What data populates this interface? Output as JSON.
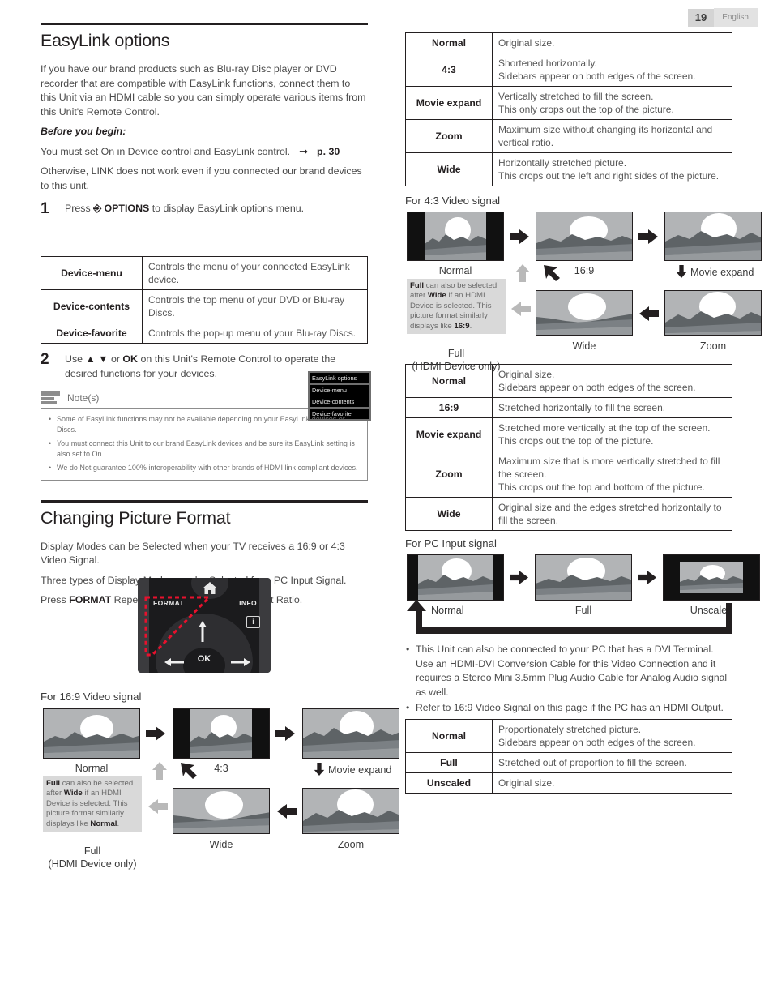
{
  "header": {
    "page_number": "19",
    "language": "English"
  },
  "left": {
    "section1_title": "EasyLink options",
    "intro": "If you have our brand products such as Blu-ray Disc player or DVD recorder that are compatible with EasyLink functions, connect them to this Unit via an HDMI cable so you can simply operate various items from this Unit's Remote Control.",
    "before_you_begin": "Before you begin:",
    "must_set": "You must set On in Device control and EasyLink control.",
    "page_ref": "p. 30",
    "otherwise": "Otherwise, LINK does not work even if you connected our brand devices to this unit.",
    "step1_num": "1",
    "step1_pre": "Press",
    "step1_options": "OPTIONS",
    "step1_post": "to display EasyLink options menu.",
    "osd_menu": [
      "EasyLink options",
      "Device-menu",
      "Device-contents",
      "Device-favorite"
    ],
    "easylink_table": [
      {
        "key": "Device-menu",
        "desc": "Controls the menu of your connected EasyLink device."
      },
      {
        "key": "Device-contents",
        "desc": "Controls the top menu of your DVD or Blu-ray Discs."
      },
      {
        "key": "Device-favorite",
        "desc": "Controls the pop-up menu of your Blu-ray Discs."
      }
    ],
    "step2_num": "2",
    "step2_a": "Use",
    "step2_arrows": "▲ ▼",
    "step2_b": "or",
    "step2_ok": "OK",
    "step2_c": "on this Unit's Remote Control to operate the desired functions for your devices.",
    "notes_label": "Note(s)",
    "notes": [
      "Some of EasyLink functions may not be available depending on your EasyLink devices or Discs.",
      "You must connect this Unit to our brand EasyLink devices and be sure its EasyLink setting is also set to On.",
      "We do Not guarantee 100% interoperability with other brands of HDMI link compliant devices."
    ],
    "section2_title": "Changing Picture Format",
    "pf_p1": "Display Modes can be Selected when your TV receives a 16:9 or 4:3 Video Signal.",
    "pf_p2": "Three types of Display Modes can be Selected for a PC Input Signal.",
    "pf_p3_a": "Press",
    "pf_p3_b": "FORMAT",
    "pf_p3_c": "Repeatedly to Switch the TV Aspect Ratio.",
    "remote": {
      "format_label": "FORMAT",
      "info_label": "INFO",
      "ok_label": "OK",
      "info_glyph": "i"
    },
    "diagram_169_title": "For 16:9 Video signal",
    "diagram_169": {
      "captions": [
        "Normal",
        "4:3",
        "Movie expand",
        "Wide",
        "Zoom"
      ],
      "full_caption": "Full",
      "full_sub": "(HDMI Device only)",
      "note_parts": [
        "Full",
        " can also be selected after ",
        "Wide",
        " if an HDMI Device is selected. This picture format similarly displays like ",
        "Normal",
        "."
      ]
    }
  },
  "right": {
    "table_169": [
      {
        "key": "Normal",
        "lines": [
          "Original size."
        ]
      },
      {
        "key": "4:3",
        "lines": [
          "Shortened horizontally.",
          "Sidebars appear on both edges of the screen."
        ]
      },
      {
        "key": "Movie expand",
        "lines": [
          "Vertically stretched to fill the screen.",
          "This only crops out the top of the picture."
        ]
      },
      {
        "key": "Zoom",
        "lines": [
          "Maximum size without changing its horizontal and vertical ratio."
        ]
      },
      {
        "key": "Wide",
        "lines": [
          "Horizontally stretched picture.",
          "This crops out the left and right sides of the picture."
        ]
      }
    ],
    "diagram_43_title": "For 4:3 Video signal",
    "diagram_43": {
      "captions": [
        "Normal",
        "16:9",
        "Movie expand",
        "Wide",
        "Zoom"
      ],
      "full_caption": "Full",
      "full_sub": "(HDMI Device only)",
      "note_parts": [
        "Full",
        " can also be selected after ",
        "Wide",
        " if an HDMI Device is selected. This picture format similarly displays like ",
        "16:9",
        "."
      ]
    },
    "table_43": [
      {
        "key": "Normal",
        "lines": [
          "Original size.",
          "Sidebars appear on both edges of the screen."
        ]
      },
      {
        "key": "16:9",
        "lines": [
          "Stretched horizontally to fill the screen."
        ]
      },
      {
        "key": "Movie expand",
        "lines": [
          "Stretched more vertically at the top of the screen.",
          "This crops out the top of the picture."
        ]
      },
      {
        "key": "Zoom",
        "lines": [
          "Maximum size that is more vertically stretched to fill the screen.",
          "This crops out the top and bottom of the picture."
        ]
      },
      {
        "key": "Wide",
        "lines": [
          "Original size and the edges stretched horizontally to fill the screen."
        ]
      }
    ],
    "diagram_pc_title": "For PC Input signal",
    "diagram_pc": {
      "captions": [
        "Normal",
        "Full",
        "Unscaled"
      ]
    },
    "pc_bullets": [
      "This Unit can also be connected to your PC that has a DVI Terminal. Use an HDMI-DVI Conversion Cable for this Video Connection and it requires a Stereo Mini 3.5mm Plug Audio Cable for Analog Audio signal as well.",
      "Refer to 16:9 Video Signal on this page if the PC has an HDMI Output."
    ],
    "table_pc": [
      {
        "key": "Normal",
        "lines": [
          "Proportionately stretched picture.",
          "Sidebars appear on both edges of the screen."
        ]
      },
      {
        "key": "Full",
        "lines": [
          "Stretched out of proportion to fill the screen."
        ]
      },
      {
        "key": "Unscaled",
        "lines": [
          "Original size."
        ]
      }
    ]
  },
  "colors": {
    "ink": "#231f20",
    "body_text": "#4a4a4a",
    "table_desc": "#575757",
    "note_gray": "#6f6f6f",
    "tv_sky": "#b2b4b6",
    "tv_mountain": "#5e6366",
    "tv_band": "#7b8084",
    "tv_water": "#969a9d",
    "tv_bezel": "#111111",
    "highlight_red": "#e8112d",
    "arrow_gray": "#b9b9b9"
  }
}
